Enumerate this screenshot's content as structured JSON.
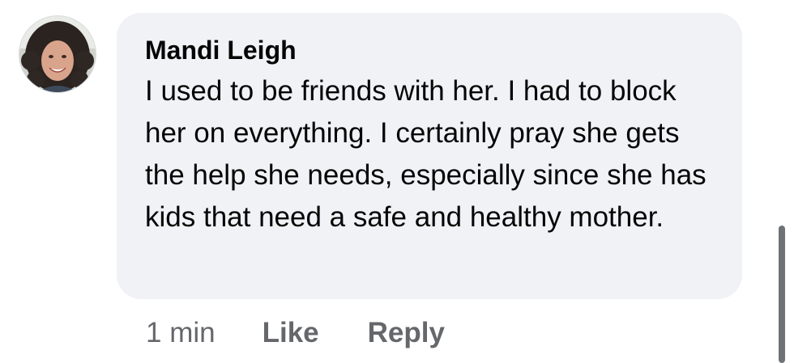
{
  "comment": {
    "avatar_icon": "profile-photo",
    "author": "Mandi Leigh",
    "text": "I used to be friends with her. I had to block her on everything. I certainly pray she gets the help she needs, especially since she has kids that need a safe and healthy mother.",
    "timestamp": "1 min",
    "like_label": "Like",
    "reply_label": "Reply"
  },
  "colors": {
    "bubble_background": "#f0f2f5",
    "text": "#050505",
    "secondary_text": "#65676b",
    "scrollbar": "#6f7276"
  }
}
